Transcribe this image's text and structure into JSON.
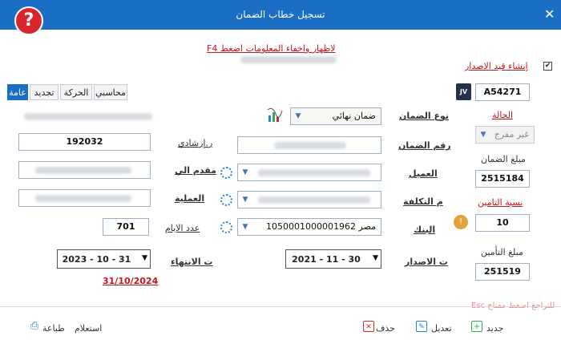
{
  "window": {
    "title": "تسجيل خطاب الضمان",
    "close": "✕",
    "help": "?"
  },
  "hint_link": "لاظهار واخفاء المعلومات اضغط F4",
  "checkbox": {
    "label": "إنشاء قيد الاصدار",
    "checked": true
  },
  "jv": {
    "badge": "JV",
    "code": "A54271"
  },
  "status": {
    "label": "الحالة",
    "value": "غير مفرج"
  },
  "guarantee_amount": {
    "label": "مبلغ الضمان",
    "value": "2515184"
  },
  "insurance_ratio": {
    "label": "نسبة التامين",
    "value": "10"
  },
  "insurance_amount": {
    "label": "مبلغ التأمين",
    "value": "251519"
  },
  "guarantee_type": {
    "label": "نوع الضمان",
    "value": "ضمان نهائي"
  },
  "guarantee_no": {
    "label": "رقم الضمان"
  },
  "client": {
    "label": "العميل"
  },
  "cost_center": {
    "label": "م التكلفة"
  },
  "bank": {
    "label": "البنك",
    "value": "مصر 1050001000001962"
  },
  "issue_date": {
    "label": "ت الاصدار",
    "value": "2021 - 11 - 30"
  },
  "tabs": [
    "عامة",
    "تجديد",
    "الحركة",
    "محاسبي"
  ],
  "guidance_no": {
    "label": "ر.إرشادي",
    "value": "192032"
  },
  "submitted_to": {
    "label": "مقدم الي"
  },
  "operation": {
    "label": "العملية"
  },
  "days": {
    "label": "عدد الايام",
    "value": "701"
  },
  "end_date": {
    "label": "ت الانتهاء",
    "value": "2023 - 10 - 31",
    "note": "31/10/2024"
  },
  "esc_hint": "للتراجع اضغط مفتاح Esc",
  "footer": {
    "new": "جديد",
    "edit": "تعديل",
    "delete": "حذف",
    "query": "استعلام",
    "print": "طباعة"
  },
  "colors": {
    "accent": "#1a6fc4",
    "link_red": "#c4161c"
  }
}
